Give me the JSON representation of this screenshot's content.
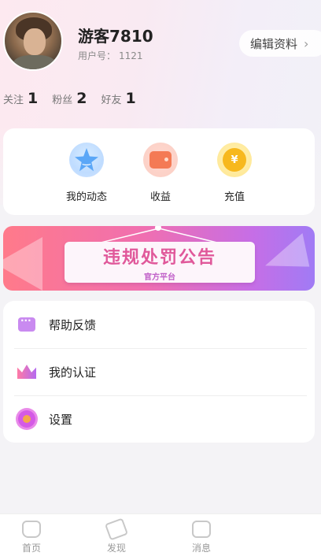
{
  "profile": {
    "username": "游客7810",
    "user_id_label": "用户号：",
    "user_id": "1121",
    "edit_button": "编辑资料"
  },
  "stats": [
    {
      "label": "关注",
      "value": "1"
    },
    {
      "label": "粉丝",
      "value": "2"
    },
    {
      "label": "好友",
      "value": "1"
    }
  ],
  "quick_actions": [
    {
      "label": "我的动态",
      "icon": "star-icon"
    },
    {
      "label": "收益",
      "icon": "wallet-icon"
    },
    {
      "label": "充值",
      "icon": "coin-icon"
    }
  ],
  "coin_symbol": "¥",
  "banner": {
    "title": "违规处罚公告",
    "subtitle": "官方平台"
  },
  "menu": [
    {
      "label": "帮助反馈",
      "icon": "chat-icon"
    },
    {
      "label": "我的认证",
      "icon": "crown-icon"
    },
    {
      "label": "设置",
      "icon": "flower-icon"
    }
  ],
  "tabbar": [
    {
      "label": "首页",
      "icon": "home-icon"
    },
    {
      "label": "发现",
      "icon": "discover-icon"
    },
    {
      "label": "消息",
      "icon": "message-icon"
    }
  ],
  "colors": {
    "banner_start": "#ff7a8a",
    "banner_end": "#a07bf5",
    "accent_pink": "#e0589a"
  }
}
